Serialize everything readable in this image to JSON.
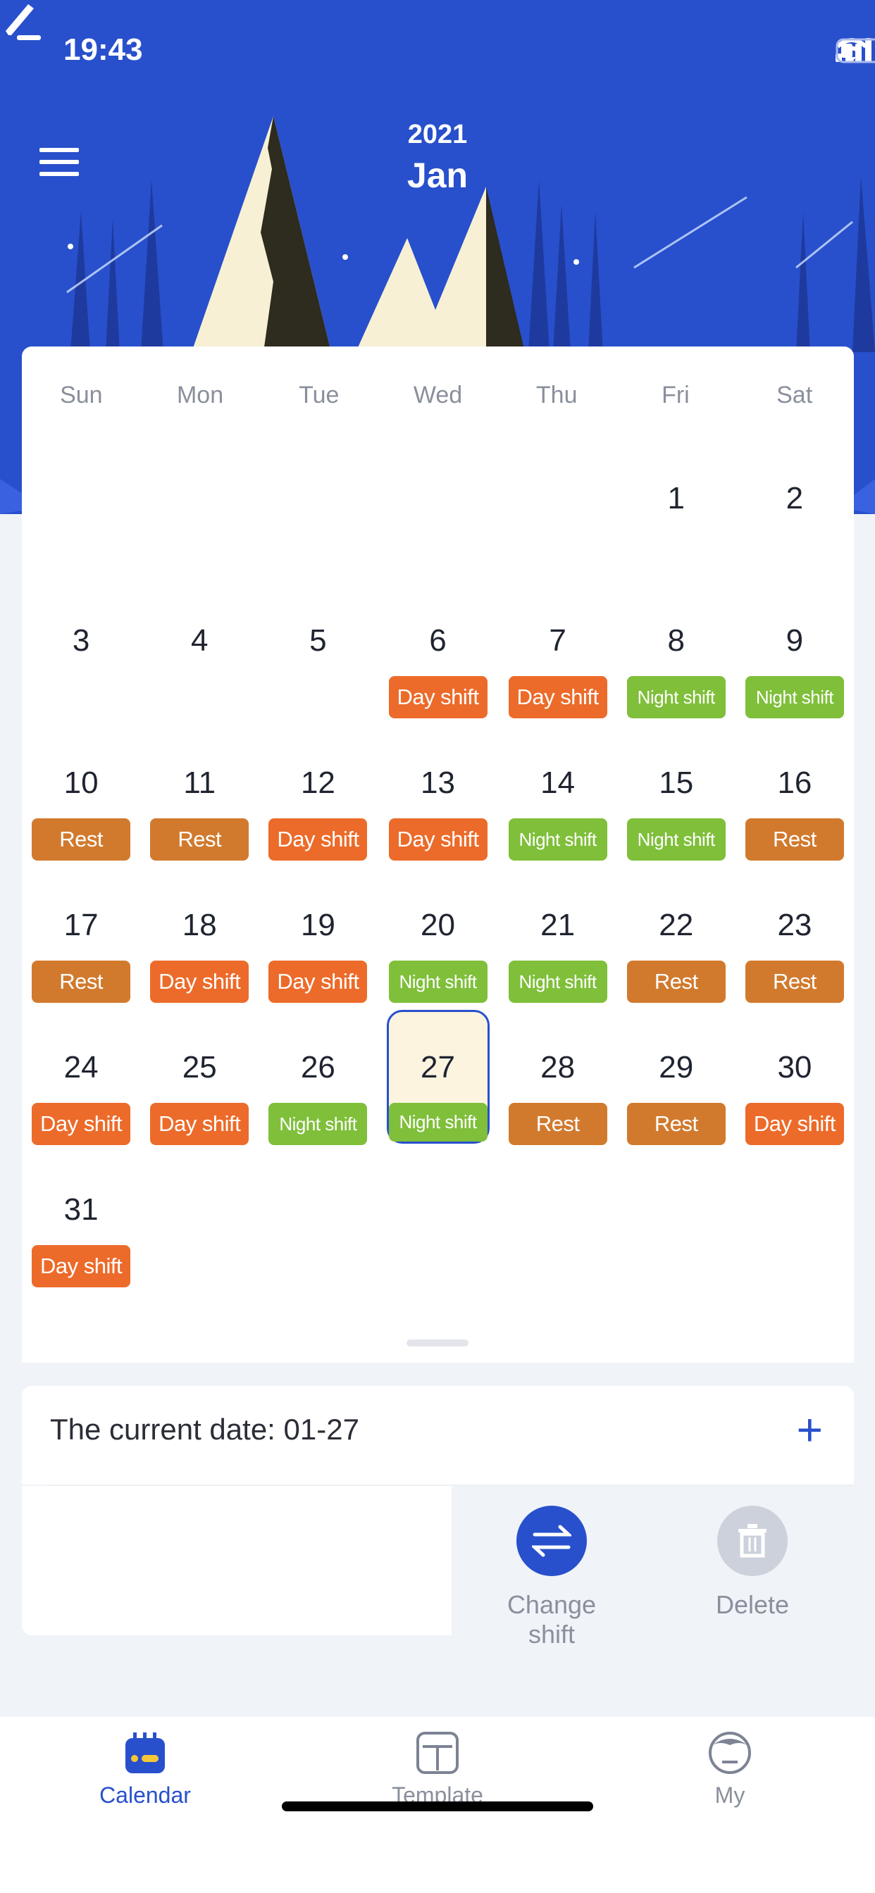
{
  "status": {
    "time": "19:43"
  },
  "header": {
    "year": "2021",
    "month": "Jan"
  },
  "colors": {
    "brand": "#2850CC",
    "day_shift": "#EC6B2A",
    "night_shift": "#7FBF3A",
    "rest": "#D17A2E",
    "selected_bg": "#FDF4E0"
  },
  "weekdays": [
    "Sun",
    "Mon",
    "Tue",
    "Wed",
    "Thu",
    "Fri",
    "Sat"
  ],
  "calendar": {
    "leading_blanks": 5,
    "selected_day": 27,
    "days": [
      {
        "d": "1",
        "s": ""
      },
      {
        "d": "2",
        "s": ""
      },
      {
        "d": "3",
        "s": ""
      },
      {
        "d": "4",
        "s": ""
      },
      {
        "d": "5",
        "s": ""
      },
      {
        "d": "6",
        "s": "Day shift"
      },
      {
        "d": "7",
        "s": "Day shift"
      },
      {
        "d": "8",
        "s": "Night shift"
      },
      {
        "d": "9",
        "s": "Night shift"
      },
      {
        "d": "10",
        "s": "Rest"
      },
      {
        "d": "11",
        "s": "Rest"
      },
      {
        "d": "12",
        "s": "Day shift"
      },
      {
        "d": "13",
        "s": "Day shift"
      },
      {
        "d": "14",
        "s": "Night shift"
      },
      {
        "d": "15",
        "s": "Night shift"
      },
      {
        "d": "16",
        "s": "Rest"
      },
      {
        "d": "17",
        "s": "Rest"
      },
      {
        "d": "18",
        "s": "Day shift"
      },
      {
        "d": "19",
        "s": "Day shift"
      },
      {
        "d": "20",
        "s": "Night shift"
      },
      {
        "d": "21",
        "s": "Night shift"
      },
      {
        "d": "22",
        "s": "Rest"
      },
      {
        "d": "23",
        "s": "Rest"
      },
      {
        "d": "24",
        "s": "Day shift"
      },
      {
        "d": "25",
        "s": "Day shift"
      },
      {
        "d": "26",
        "s": "Night shift"
      },
      {
        "d": "27",
        "s": "Night shift"
      },
      {
        "d": "28",
        "s": "Rest"
      },
      {
        "d": "29",
        "s": "Rest"
      },
      {
        "d": "30",
        "s": "Day shift"
      },
      {
        "d": "31",
        "s": "Day shift"
      }
    ]
  },
  "info": {
    "current_date": "The current date: 01-27"
  },
  "actions": {
    "change_shift": "Change shift",
    "delete": "Delete"
  },
  "tabs": [
    {
      "label": "Calendar",
      "icon": "calendar-icon",
      "active": true
    },
    {
      "label": "Template",
      "icon": "template-icon"
    },
    {
      "label": "My",
      "icon": "profile-icon"
    }
  ]
}
